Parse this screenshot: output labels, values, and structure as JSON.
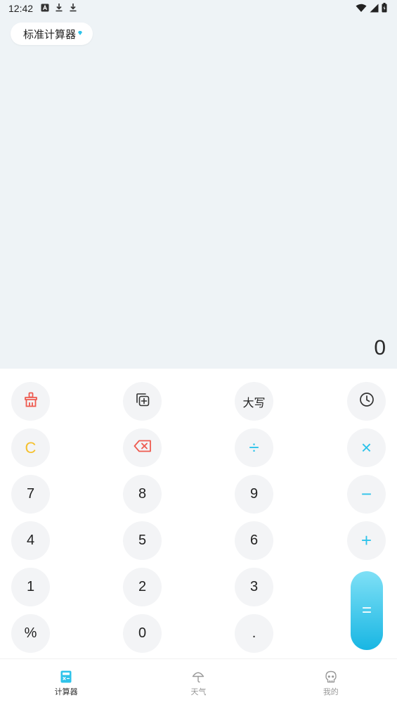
{
  "status_bar": {
    "time": "12:42",
    "left_icons": [
      "a-app-icon",
      "download-icon",
      "download-icon"
    ],
    "right_icons": [
      "wifi-icon",
      "cell-signal-icon",
      "battery-icon"
    ]
  },
  "header": {
    "mode_label": "标准计算器"
  },
  "display": {
    "result": "0"
  },
  "keys": {
    "clean": "clean-icon",
    "copy": "copy-icon",
    "uppercase_label": "大写",
    "history": "history-icon",
    "c_label": "C",
    "backspace": "backspace-icon",
    "divide_label": "÷",
    "multiply_label": "×",
    "seven": "7",
    "eight": "8",
    "nine": "9",
    "minus_label": "−",
    "four": "4",
    "five": "5",
    "six": "6",
    "plus_label": "+",
    "one": "1",
    "two": "2",
    "three": "3",
    "equals_label": "=",
    "percent_label": "%",
    "zero": "0",
    "dot_label": "."
  },
  "nav": {
    "calculator_label": "计算器",
    "weather_label": "天气",
    "mine_label": "我的"
  },
  "colors": {
    "accent": "#2ec3ea",
    "clean_red": "#ee5a4f",
    "clear_yellow": "#f5c12e",
    "display_bg": "#eef3f6"
  }
}
